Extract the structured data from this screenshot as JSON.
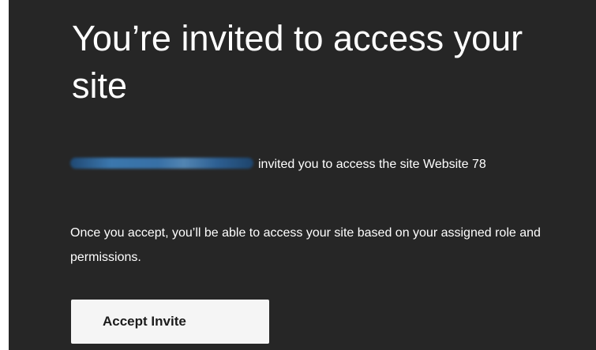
{
  "email": {
    "title": "You’re invited to access your site",
    "invite_text": "invited you to access the site Website 78",
    "body_text": "Once you accept, you’ll be able to access your site based on your assigned role and permissions.",
    "accept_button_label": "Accept Invite"
  },
  "colors": {
    "background": "#262626",
    "text": "#ffffff",
    "button_background": "#f5f5f5",
    "button_text": "#1b1b1b"
  }
}
